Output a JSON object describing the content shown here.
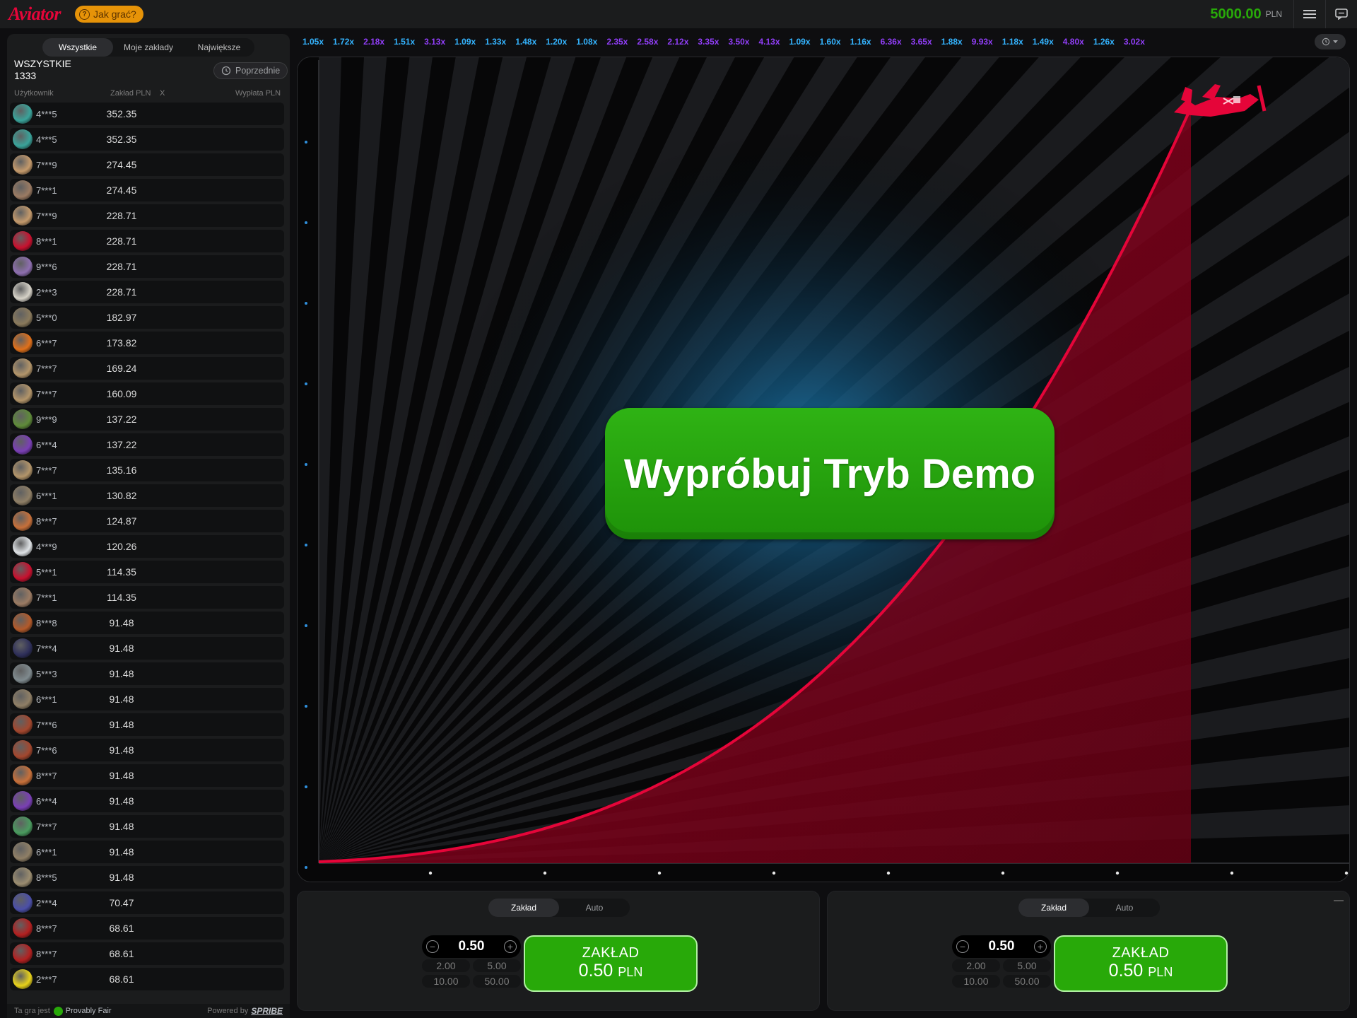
{
  "header": {
    "logo": "Aviator",
    "how_to_play": "Jak grać?",
    "how_to_icon": "?",
    "balance": "5000.00",
    "currency": "PLN"
  },
  "sidebar": {
    "tabs": [
      "Wszystkie",
      "Moje zakłady",
      "Największe"
    ],
    "title": "WSZYSTKIE",
    "count": "1333",
    "previous_button": "Poprzednie",
    "columns": {
      "user": "Użytkownik",
      "bet": "Zakład PLN",
      "x": "X",
      "payout": "Wypłata PLN"
    },
    "rows": [
      {
        "user": "4***5",
        "bet": "352.35",
        "avatar": "#3aa39a"
      },
      {
        "user": "4***5",
        "bet": "352.35",
        "avatar": "#3aa39a"
      },
      {
        "user": "7***9",
        "bet": "274.45",
        "avatar": "#c49a6c"
      },
      {
        "user": "7***1",
        "bet": "274.45",
        "avatar": "#9b7b63"
      },
      {
        "user": "7***9",
        "bet": "228.71",
        "avatar": "#c49a6c"
      },
      {
        "user": "8***1",
        "bet": "228.71",
        "avatar": "#c8102e"
      },
      {
        "user": "9***6",
        "bet": "228.71",
        "avatar": "#8e6fb0"
      },
      {
        "user": "2***3",
        "bet": "228.71",
        "avatar": "#d6d2c8"
      },
      {
        "user": "5***0",
        "bet": "182.97",
        "avatar": "#8a7a5c"
      },
      {
        "user": "6***7",
        "bet": "173.82",
        "avatar": "#e0701a"
      },
      {
        "user": "7***7",
        "bet": "169.24",
        "avatar": "#b3956a"
      },
      {
        "user": "7***7",
        "bet": "160.09",
        "avatar": "#b3956a"
      },
      {
        "user": "9***9",
        "bet": "137.22",
        "avatar": "#5f8b3a"
      },
      {
        "user": "6***4",
        "bet": "137.22",
        "avatar": "#7a3fb5"
      },
      {
        "user": "7***7",
        "bet": "135.16",
        "avatar": "#b3956a"
      },
      {
        "user": "6***1",
        "bet": "130.82",
        "avatar": "#8f7f66"
      },
      {
        "user": "8***7",
        "bet": "124.87",
        "avatar": "#c7703a"
      },
      {
        "user": "4***9",
        "bet": "120.26",
        "avatar": "#dfe3e6"
      },
      {
        "user": "5***1",
        "bet": "114.35",
        "avatar": "#c8102e"
      },
      {
        "user": "7***1",
        "bet": "114.35",
        "avatar": "#9b7b63"
      },
      {
        "user": "8***8",
        "bet": "91.48",
        "avatar": "#b35a2a"
      },
      {
        "user": "7***4",
        "bet": "91.48",
        "avatar": "#2e2f5a"
      },
      {
        "user": "5***3",
        "bet": "91.48",
        "avatar": "#7f8a8e"
      },
      {
        "user": "6***1",
        "bet": "91.48",
        "avatar": "#8f7f66"
      },
      {
        "user": "7***6",
        "bet": "91.48",
        "avatar": "#a3472e"
      },
      {
        "user": "7***6",
        "bet": "91.48",
        "avatar": "#a3472e"
      },
      {
        "user": "8***7",
        "bet": "91.48",
        "avatar": "#c7703a"
      },
      {
        "user": "6***4",
        "bet": "91.48",
        "avatar": "#7a3fb5"
      },
      {
        "user": "7***7",
        "bet": "91.48",
        "avatar": "#4a9b5f"
      },
      {
        "user": "6***1",
        "bet": "91.48",
        "avatar": "#8f7f66"
      },
      {
        "user": "8***5",
        "bet": "91.48",
        "avatar": "#9b8d70"
      },
      {
        "user": "2***4",
        "bet": "70.47",
        "avatar": "#4b4fa8"
      },
      {
        "user": "8***7",
        "bet": "68.61",
        "avatar": "#b32020"
      },
      {
        "user": "8***7",
        "bet": "68.61",
        "avatar": "#b32020"
      },
      {
        "user": "2***7",
        "bet": "68.61",
        "avatar": "#e8d21a"
      }
    ],
    "footer": {
      "game_is": "Ta gra jest",
      "provably_fair": "Provably Fair",
      "powered_by": "Powered by",
      "brand": "SPRIBE"
    }
  },
  "history": [
    {
      "v": "1.05x",
      "color": "#34b4ff"
    },
    {
      "v": "1.72x",
      "color": "#34b4ff"
    },
    {
      "v": "2.18x",
      "color": "#913ef8"
    },
    {
      "v": "1.51x",
      "color": "#34b4ff"
    },
    {
      "v": "3.13x",
      "color": "#913ef8"
    },
    {
      "v": "1.09x",
      "color": "#34b4ff"
    },
    {
      "v": "1.33x",
      "color": "#34b4ff"
    },
    {
      "v": "1.48x",
      "color": "#34b4ff"
    },
    {
      "v": "1.20x",
      "color": "#34b4ff"
    },
    {
      "v": "1.08x",
      "color": "#34b4ff"
    },
    {
      "v": "2.35x",
      "color": "#913ef8"
    },
    {
      "v": "2.58x",
      "color": "#913ef8"
    },
    {
      "v": "2.12x",
      "color": "#913ef8"
    },
    {
      "v": "3.35x",
      "color": "#913ef8"
    },
    {
      "v": "3.50x",
      "color": "#913ef8"
    },
    {
      "v": "4.13x",
      "color": "#913ef8"
    },
    {
      "v": "1.09x",
      "color": "#34b4ff"
    },
    {
      "v": "1.60x",
      "color": "#34b4ff"
    },
    {
      "v": "1.16x",
      "color": "#34b4ff"
    },
    {
      "v": "6.36x",
      "color": "#913ef8"
    },
    {
      "v": "3.65x",
      "color": "#913ef8"
    },
    {
      "v": "1.88x",
      "color": "#34b4ff"
    },
    {
      "v": "9.93x",
      "color": "#913ef8"
    },
    {
      "v": "1.18x",
      "color": "#34b4ff"
    },
    {
      "v": "1.49x",
      "color": "#34b4ff"
    },
    {
      "v": "4.80x",
      "color": "#913ef8"
    },
    {
      "v": "1.26x",
      "color": "#34b4ff"
    },
    {
      "v": "3.02x",
      "color": "#913ef8"
    }
  ],
  "game": {
    "demo_button": "Wypróbuj Tryb Demo",
    "curve_color": "#e50539",
    "plane_icon": "plane-icon"
  },
  "bet_panels": [
    {
      "tabs": [
        "Zakład",
        "Auto"
      ],
      "amount": "0.50",
      "quick": [
        "2.00",
        "5.00",
        "10.00",
        "50.00"
      ],
      "button_line1": "ZAKŁAD",
      "button_amount": "0.50",
      "button_currency": "PLN"
    },
    {
      "tabs": [
        "Zakład",
        "Auto"
      ],
      "amount": "0.50",
      "quick": [
        "2.00",
        "5.00",
        "10.00",
        "50.00"
      ],
      "button_line1": "ZAKŁAD",
      "button_amount": "0.50",
      "button_currency": "PLN"
    }
  ]
}
